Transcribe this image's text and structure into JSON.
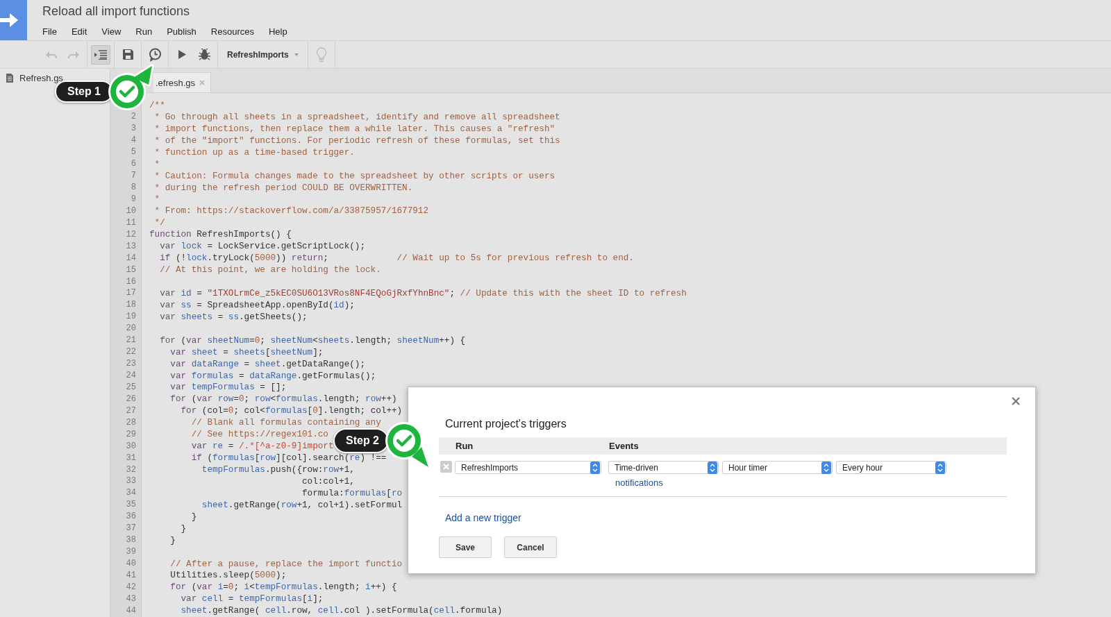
{
  "app": {
    "title": "Reload all import functions",
    "menu": [
      "File",
      "Edit",
      "View",
      "Run",
      "Publish",
      "Resources",
      "Help"
    ]
  },
  "toolbar": {
    "groups": [
      [
        {
          "kind": "undo",
          "disabled": true,
          "pressed": false
        },
        {
          "kind": "redo",
          "disabled": true,
          "pressed": false
        }
      ],
      [
        {
          "kind": "indent",
          "disabled": false,
          "pressed": true
        }
      ],
      [
        {
          "kind": "save",
          "disabled": false,
          "pressed": false
        }
      ],
      [
        {
          "kind": "triggers",
          "disabled": false,
          "pressed": false
        }
      ],
      [
        {
          "kind": "run",
          "disabled": false,
          "pressed": false
        },
        {
          "kind": "debug",
          "disabled": false,
          "pressed": false
        }
      ],
      [
        {
          "kind": "function_select",
          "label": "RefreshImports",
          "disabled": false,
          "pressed": false
        }
      ],
      [
        {
          "kind": "tip",
          "disabled": true,
          "pressed": false
        }
      ]
    ]
  },
  "sidebar": {
    "files": [
      {
        "name": "Refresh.gs"
      }
    ]
  },
  "editor": {
    "tab": {
      "label": ".efresh.gs"
    },
    "lines": [
      {
        "tokens": [
          {
            "kind": "comment",
            "text": "/**"
          }
        ]
      },
      {
        "number": "2",
        "tokens": [
          {
            "kind": "comment",
            "text": " * Go through all sheets in a spreadsheet, identify and remove all spreadsheet"
          }
        ]
      },
      {
        "number": "3",
        "tokens": [
          {
            "kind": "comment",
            "text": " * import functions, then replace them a while later. This causes a \"refresh\""
          }
        ]
      },
      {
        "number": "4",
        "tokens": [
          {
            "kind": "comment",
            "text": " * of the \"import\" functions. For periodic refresh of these formulas, set this"
          }
        ]
      },
      {
        "number": "5",
        "tokens": [
          {
            "kind": "comment",
            "text": " * function up as a time-based trigger."
          }
        ]
      },
      {
        "number": "6",
        "tokens": [
          {
            "kind": "comment",
            "text": " *"
          }
        ]
      },
      {
        "number": "7",
        "tokens": [
          {
            "kind": "comment",
            "text": " * Caution: Formula changes made to the spreadsheet by other scripts or users"
          }
        ]
      },
      {
        "number": "8",
        "tokens": [
          {
            "kind": "comment",
            "text": " * during the refresh period COULD BE OVERWRITTEN."
          }
        ]
      },
      {
        "number": "9",
        "tokens": [
          {
            "kind": "comment",
            "text": " *"
          }
        ]
      },
      {
        "number": "10",
        "tokens": [
          {
            "kind": "comment",
            "text": " * From: https://stackoverflow.com/a/33875957/1677912"
          }
        ]
      },
      {
        "number": "11",
        "tokens": [
          {
            "kind": "comment",
            "text": " */"
          }
        ]
      },
      {
        "number": "12",
        "tokens": [
          {
            "kind": "keyword",
            "text": "function"
          },
          {
            "kind": "plain",
            "text": " RefreshImports() {"
          }
        ]
      },
      {
        "number": "13",
        "tokens": [
          {
            "kind": "keyword",
            "text": "  var"
          },
          {
            "kind": "name",
            "text": " lock"
          },
          {
            "kind": "plain",
            "text": " = LockService.getScriptLock();"
          }
        ]
      },
      {
        "number": "14",
        "tokens": [
          {
            "kind": "keyword",
            "text": "  if"
          },
          {
            "kind": "plain",
            "text": " (!"
          },
          {
            "kind": "name",
            "text": "lock"
          },
          {
            "kind": "plain",
            "text": ".tryLock("
          },
          {
            "kind": "number",
            "text": "5000"
          },
          {
            "kind": "plain",
            "text": ")) "
          },
          {
            "kind": "keyword",
            "text": "return"
          },
          {
            "kind": "plain",
            "text": ";             "
          },
          {
            "kind": "comment",
            "text": "// Wait up to 5s for previous refresh to end."
          }
        ]
      },
      {
        "number": "15",
        "tokens": [
          {
            "kind": "comment",
            "text": "  // At this point, we are holding the lock."
          }
        ]
      },
      {
        "number": "16"
      },
      {
        "number": "17",
        "tokens": [
          {
            "kind": "keyword",
            "text": "  var"
          },
          {
            "kind": "name",
            "text": " id"
          },
          {
            "kind": "plain",
            "text": " = "
          },
          {
            "kind": "string",
            "text": "\"1TXOLrmCe_z5kEC0SU6O13VRos8NF4EQoGjRxfYhnBnc\""
          },
          {
            "kind": "plain",
            "text": "; "
          },
          {
            "kind": "comment",
            "text": "// Update this with the sheet ID to refresh"
          }
        ]
      },
      {
        "number": "18",
        "tokens": [
          {
            "kind": "keyword",
            "text": "  var"
          },
          {
            "kind": "name",
            "text": " ss"
          },
          {
            "kind": "plain",
            "text": " = SpreadsheetApp.openById("
          },
          {
            "kind": "name",
            "text": "id"
          },
          {
            "kind": "plain",
            "text": ");"
          }
        ]
      },
      {
        "number": "19",
        "tokens": [
          {
            "kind": "keyword",
            "text": "  var"
          },
          {
            "kind": "name",
            "text": " sheets"
          },
          {
            "kind": "plain",
            "text": " = "
          },
          {
            "kind": "name",
            "text": "ss"
          },
          {
            "kind": "plain",
            "text": ".getSheets();"
          }
        ]
      },
      {
        "number": "20"
      },
      {
        "number": "21",
        "tokens": [
          {
            "kind": "keyword",
            "text": "  for"
          },
          {
            "kind": "plain",
            "text": " ("
          },
          {
            "kind": "keyword",
            "text": "var"
          },
          {
            "kind": "name",
            "text": " sheetNum"
          },
          {
            "kind": "plain",
            "text": "="
          },
          {
            "kind": "number",
            "text": "0"
          },
          {
            "kind": "plain",
            "text": "; "
          },
          {
            "kind": "name",
            "text": "sheetNum"
          },
          {
            "kind": "plain",
            "text": "<"
          },
          {
            "kind": "name",
            "text": "sheets"
          },
          {
            "kind": "plain",
            "text": ".length; "
          },
          {
            "kind": "name",
            "text": "sheetNum"
          },
          {
            "kind": "plain",
            "text": "++) {"
          }
        ]
      },
      {
        "number": "22",
        "tokens": [
          {
            "kind": "keyword",
            "text": "    var"
          },
          {
            "kind": "name",
            "text": " sheet"
          },
          {
            "kind": "plain",
            "text": " = "
          },
          {
            "kind": "name",
            "text": "sheets"
          },
          {
            "kind": "plain",
            "text": "["
          },
          {
            "kind": "name",
            "text": "sheetNum"
          },
          {
            "kind": "plain",
            "text": "];"
          }
        ]
      },
      {
        "number": "23",
        "tokens": [
          {
            "kind": "keyword",
            "text": "    var"
          },
          {
            "kind": "name",
            "text": " dataRange"
          },
          {
            "kind": "plain",
            "text": " = "
          },
          {
            "kind": "name",
            "text": "sheet"
          },
          {
            "kind": "plain",
            "text": ".getDataRange();"
          }
        ]
      },
      {
        "number": "24",
        "tokens": [
          {
            "kind": "keyword",
            "text": "    var"
          },
          {
            "kind": "name",
            "text": " formulas"
          },
          {
            "kind": "plain",
            "text": " = "
          },
          {
            "kind": "name",
            "text": "dataRange"
          },
          {
            "kind": "plain",
            "text": ".getFormulas();"
          }
        ]
      },
      {
        "number": "25",
        "tokens": [
          {
            "kind": "keyword",
            "text": "    var"
          },
          {
            "kind": "name",
            "text": " tempFormulas"
          },
          {
            "kind": "plain",
            "text": " = [];"
          }
        ]
      },
      {
        "number": "26",
        "tokens": [
          {
            "kind": "keyword",
            "text": "    for"
          },
          {
            "kind": "plain",
            "text": " ("
          },
          {
            "kind": "keyword",
            "text": "var"
          },
          {
            "kind": "name",
            "text": " row"
          },
          {
            "kind": "plain",
            "text": "="
          },
          {
            "kind": "number",
            "text": "0"
          },
          {
            "kind": "plain",
            "text": "; "
          },
          {
            "kind": "name",
            "text": "row"
          },
          {
            "kind": "plain",
            "text": "<"
          },
          {
            "kind": "name",
            "text": "formulas"
          },
          {
            "kind": "plain",
            "text": ".length; "
          },
          {
            "kind": "name",
            "text": "row"
          },
          {
            "kind": "plain",
            "text": "++)"
          }
        ]
      },
      {
        "number": "27",
        "tokens": [
          {
            "kind": "keyword",
            "text": "      for"
          },
          {
            "kind": "plain",
            "text": " (col="
          },
          {
            "kind": "number",
            "text": "0"
          },
          {
            "kind": "plain",
            "text": "; col<"
          },
          {
            "kind": "name",
            "text": "formulas"
          },
          {
            "kind": "plain",
            "text": "["
          },
          {
            "kind": "number",
            "text": "0"
          },
          {
            "kind": "plain",
            "text": "].length; col++)"
          }
        ]
      },
      {
        "number": "28",
        "tokens": [
          {
            "kind": "comment",
            "text": "        // Blank all formulas containing any"
          }
        ]
      },
      {
        "number": "29",
        "tokens": [
          {
            "kind": "comment",
            "text": "        // See https://regex101.co"
          }
        ]
      },
      {
        "number": "30",
        "tokens": [
          {
            "kind": "keyword",
            "text": "        var"
          },
          {
            "kind": "name",
            "text": " re"
          },
          {
            "kind": "plain",
            "text": " = "
          },
          {
            "kind": "regex",
            "text": "/.*[^a-z0-9]import"
          }
        ]
      },
      {
        "number": "31",
        "tokens": [
          {
            "kind": "keyword",
            "text": "        if"
          },
          {
            "kind": "plain",
            "text": " ("
          },
          {
            "kind": "name",
            "text": "formulas"
          },
          {
            "kind": "plain",
            "text": "["
          },
          {
            "kind": "name",
            "text": "row"
          },
          {
            "kind": "plain",
            "text": "][col].search("
          },
          {
            "kind": "name",
            "text": "re"
          },
          {
            "kind": "plain",
            "text": ") !=="
          }
        ]
      },
      {
        "number": "32",
        "tokens": [
          {
            "kind": "name",
            "text": "          tempFormulas"
          },
          {
            "kind": "plain",
            "text": ".push({row:"
          },
          {
            "kind": "name",
            "text": "row"
          },
          {
            "kind": "plain",
            "text": "+1,"
          }
        ]
      },
      {
        "number": "33",
        "tokens": [
          {
            "kind": "plain",
            "text": "                             col:col+1,"
          }
        ]
      },
      {
        "number": "34",
        "tokens": [
          {
            "kind": "plain",
            "text": "                             formula:"
          },
          {
            "kind": "name",
            "text": "formulas"
          },
          {
            "kind": "plain",
            "text": "["
          },
          {
            "kind": "name",
            "text": "ro"
          }
        ]
      },
      {
        "number": "35",
        "tokens": [
          {
            "kind": "name",
            "text": "          sheet"
          },
          {
            "kind": "plain",
            "text": ".getRange("
          },
          {
            "kind": "name",
            "text": "row"
          },
          {
            "kind": "plain",
            "text": "+1, col+1).setFormul"
          }
        ]
      },
      {
        "number": "36",
        "tokens": [
          {
            "kind": "plain",
            "text": "        }"
          }
        ]
      },
      {
        "number": "37",
        "tokens": [
          {
            "kind": "plain",
            "text": "      }"
          }
        ]
      },
      {
        "number": "38",
        "tokens": [
          {
            "kind": "plain",
            "text": "    }"
          }
        ]
      },
      {
        "number": "39"
      },
      {
        "number": "40",
        "tokens": [
          {
            "kind": "comment",
            "text": "    // After a pause, replace the import functio"
          }
        ]
      },
      {
        "number": "41",
        "tokens": [
          {
            "kind": "plain",
            "text": "    Utilities.sleep("
          },
          {
            "kind": "number",
            "text": "5000"
          },
          {
            "kind": "plain",
            "text": ");"
          }
        ]
      },
      {
        "number": "42",
        "tokens": [
          {
            "kind": "keyword",
            "text": "    for"
          },
          {
            "kind": "plain",
            "text": " ("
          },
          {
            "kind": "keyword",
            "text": "var"
          },
          {
            "kind": "name",
            "text": " i"
          },
          {
            "kind": "plain",
            "text": "="
          },
          {
            "kind": "number",
            "text": "0"
          },
          {
            "kind": "plain",
            "text": "; "
          },
          {
            "kind": "name",
            "text": "i"
          },
          {
            "kind": "plain",
            "text": "<"
          },
          {
            "kind": "name",
            "text": "tempFormulas"
          },
          {
            "kind": "plain",
            "text": ".length; "
          },
          {
            "kind": "name",
            "text": "i"
          },
          {
            "kind": "plain",
            "text": "++) {"
          }
        ]
      },
      {
        "number": "43",
        "tokens": [
          {
            "kind": "keyword",
            "text": "      var"
          },
          {
            "kind": "name",
            "text": " cell"
          },
          {
            "kind": "plain",
            "text": " = "
          },
          {
            "kind": "name",
            "text": "tempFormulas"
          },
          {
            "kind": "plain",
            "text": "["
          },
          {
            "kind": "name",
            "text": "i"
          },
          {
            "kind": "plain",
            "text": "];"
          }
        ]
      },
      {
        "number": "44",
        "tokens": [
          {
            "kind": "name",
            "text": "      sheet"
          },
          {
            "kind": "plain",
            "text": ".getRange( "
          },
          {
            "kind": "name",
            "text": "cell"
          },
          {
            "kind": "plain",
            "text": ".row, "
          },
          {
            "kind": "name",
            "text": "cell"
          },
          {
            "kind": "plain",
            "text": ".col ).setFormula("
          },
          {
            "kind": "name",
            "text": "cell"
          },
          {
            "kind": "plain",
            "text": ".formula)"
          }
        ]
      }
    ]
  },
  "dialog": {
    "title": "Current project's triggers",
    "columns": [
      "Run",
      "Events"
    ],
    "triggers": [
      {
        "function": "RefreshImports",
        "event_source": "Time-driven",
        "timer_type": "Hour timer",
        "interval": "Every hour",
        "notifications": "notifications"
      }
    ],
    "add_link": "Add a new trigger",
    "buttons": [
      "Save",
      "Cancel"
    ]
  },
  "steps": [
    "Step 1",
    "Step 2"
  ]
}
